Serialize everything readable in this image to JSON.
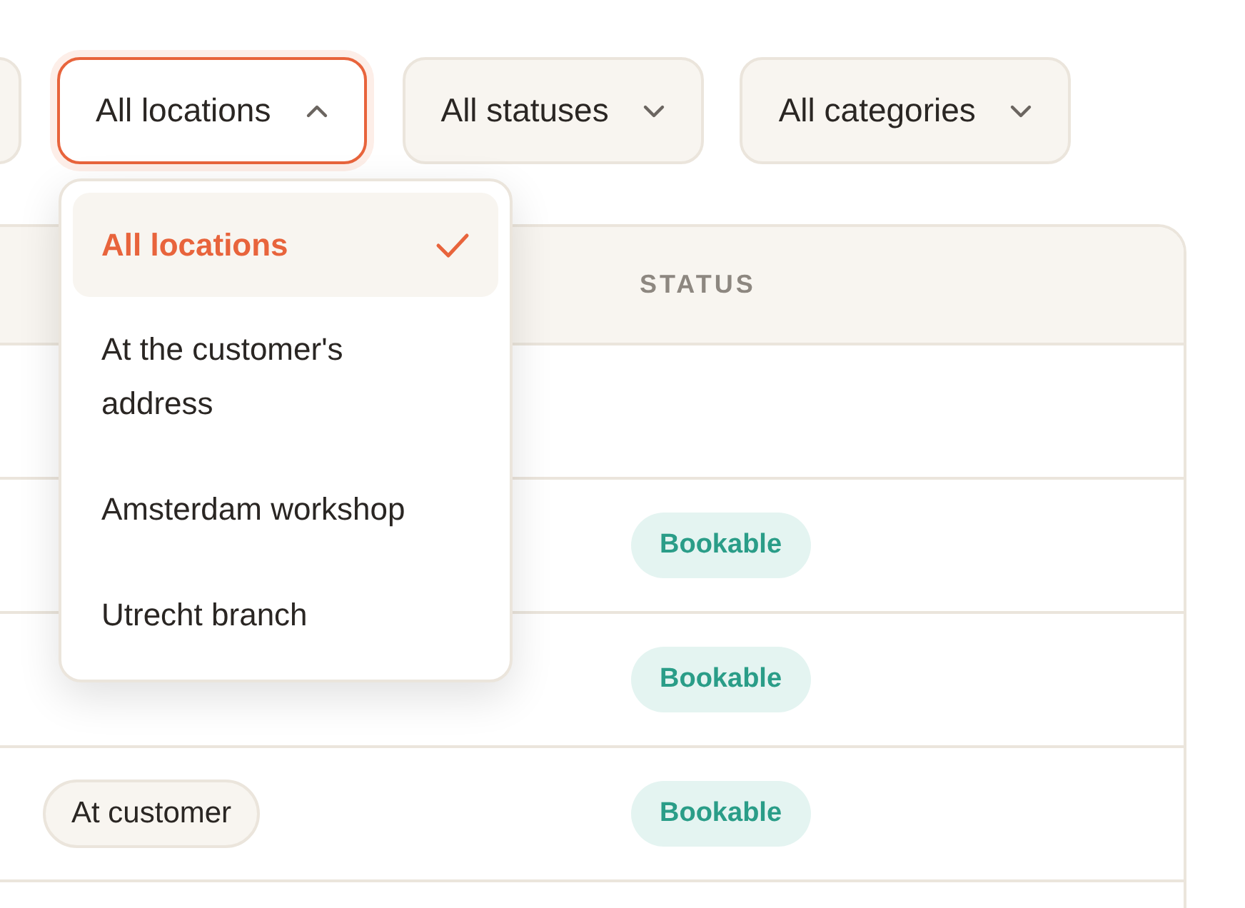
{
  "filters": [
    {
      "label": "All locations",
      "expanded": true
    },
    {
      "label": "All statuses",
      "expanded": false
    },
    {
      "label": "All categories",
      "expanded": false
    }
  ],
  "location_menu": {
    "options": [
      {
        "label": "All locations",
        "selected": true
      },
      {
        "label": "At the customer's address",
        "selected": false
      },
      {
        "label": "Amsterdam workshop",
        "selected": false
      },
      {
        "label": "Utrecht branch",
        "selected": false
      }
    ]
  },
  "table": {
    "columns": [
      "STATUS"
    ],
    "rows": [
      {},
      {
        "status": "Bookable"
      },
      {
        "status": "Bookable"
      },
      {
        "location": "At customer",
        "status": "Bookable"
      }
    ]
  }
}
